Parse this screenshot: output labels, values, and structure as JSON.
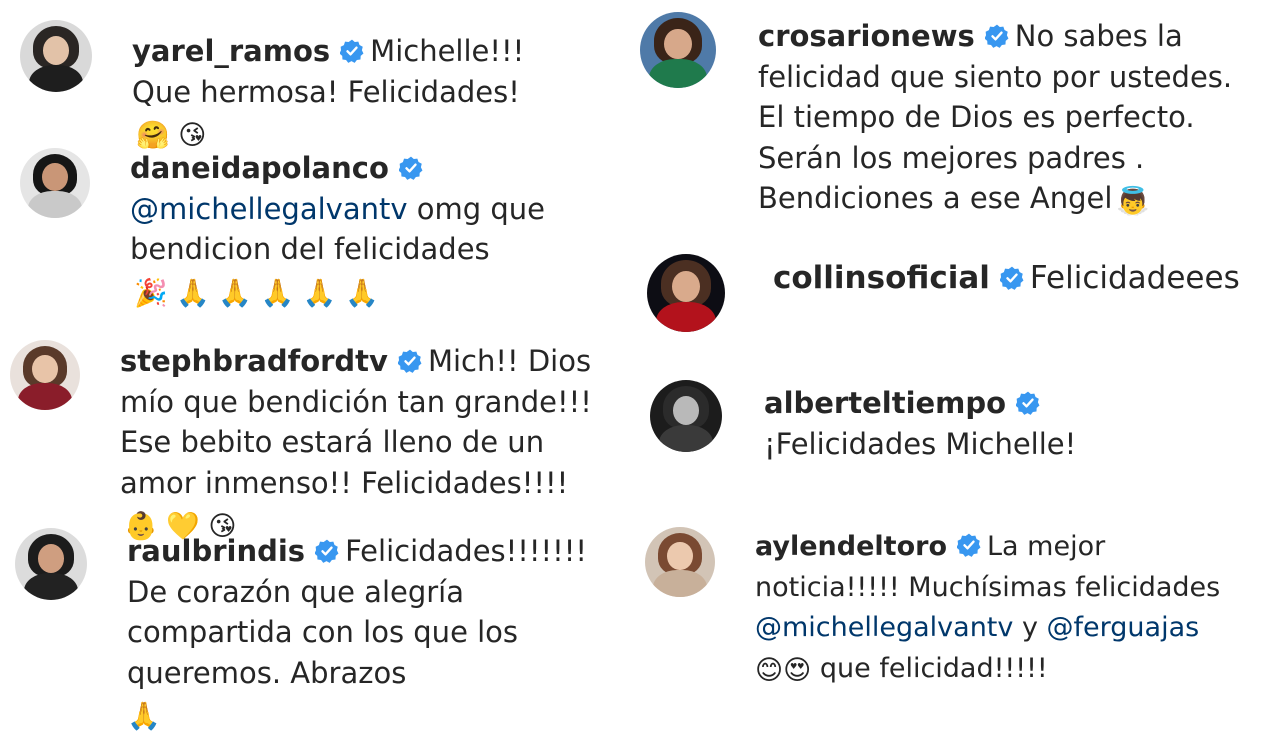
{
  "colors": {
    "text": "#262626",
    "mention": "#00376b",
    "verified": "#3897f0"
  },
  "left_comments": [
    {
      "username": "yarel_ramos",
      "before": "",
      "mention": "",
      "text": "Michelle!!! Que hermosa! Felicidades!",
      "emoji": "🤗 😘"
    },
    {
      "username": "daneidapolanco",
      "before": "",
      "mention": "@michellegalvantv",
      "text": " omg que bendicion del felicidades",
      "emoji": "🎉 🙏 🙏 🙏 🙏 🙏"
    },
    {
      "username": "stephbradfordtv",
      "before": "",
      "mention": "",
      "text": "Mich!! Dios mío que bendición tan grande!!! Ese bebito estará lleno de un amor inmenso!! Felicidades!!!!",
      "emoji": "👶 💛 😘"
    },
    {
      "username": "raulbrindis",
      "before": "",
      "mention": "",
      "text": "Felicidades!!!!!!! De corazón que alegría compartida con los que los queremos. Abrazos",
      "emoji": "🙏"
    }
  ],
  "right_comments": [
    {
      "username": "crosarionews",
      "text": "No sabes la felicidad que siento por ustedes. El tiempo de Dios es perfecto. Serán los mejores padres . Bendiciones a ese Angel",
      "emoji": "👼"
    },
    {
      "username": "collinsoficial",
      "text": "Felicidadeees",
      "emoji": ""
    },
    {
      "username": "alberteltiempo",
      "text": "¡Felicidades Michelle!",
      "emoji": ""
    },
    {
      "username": "aylendeltoro",
      "text": "La mejor noticia!!!!! Muchísimas felicidades",
      "mention1": "@michellegalvantv",
      "joiner": " y ",
      "mention2": "@ferguajas",
      "emoji": "😊😍",
      "tail": " que felicidad!!!!!"
    }
  ]
}
